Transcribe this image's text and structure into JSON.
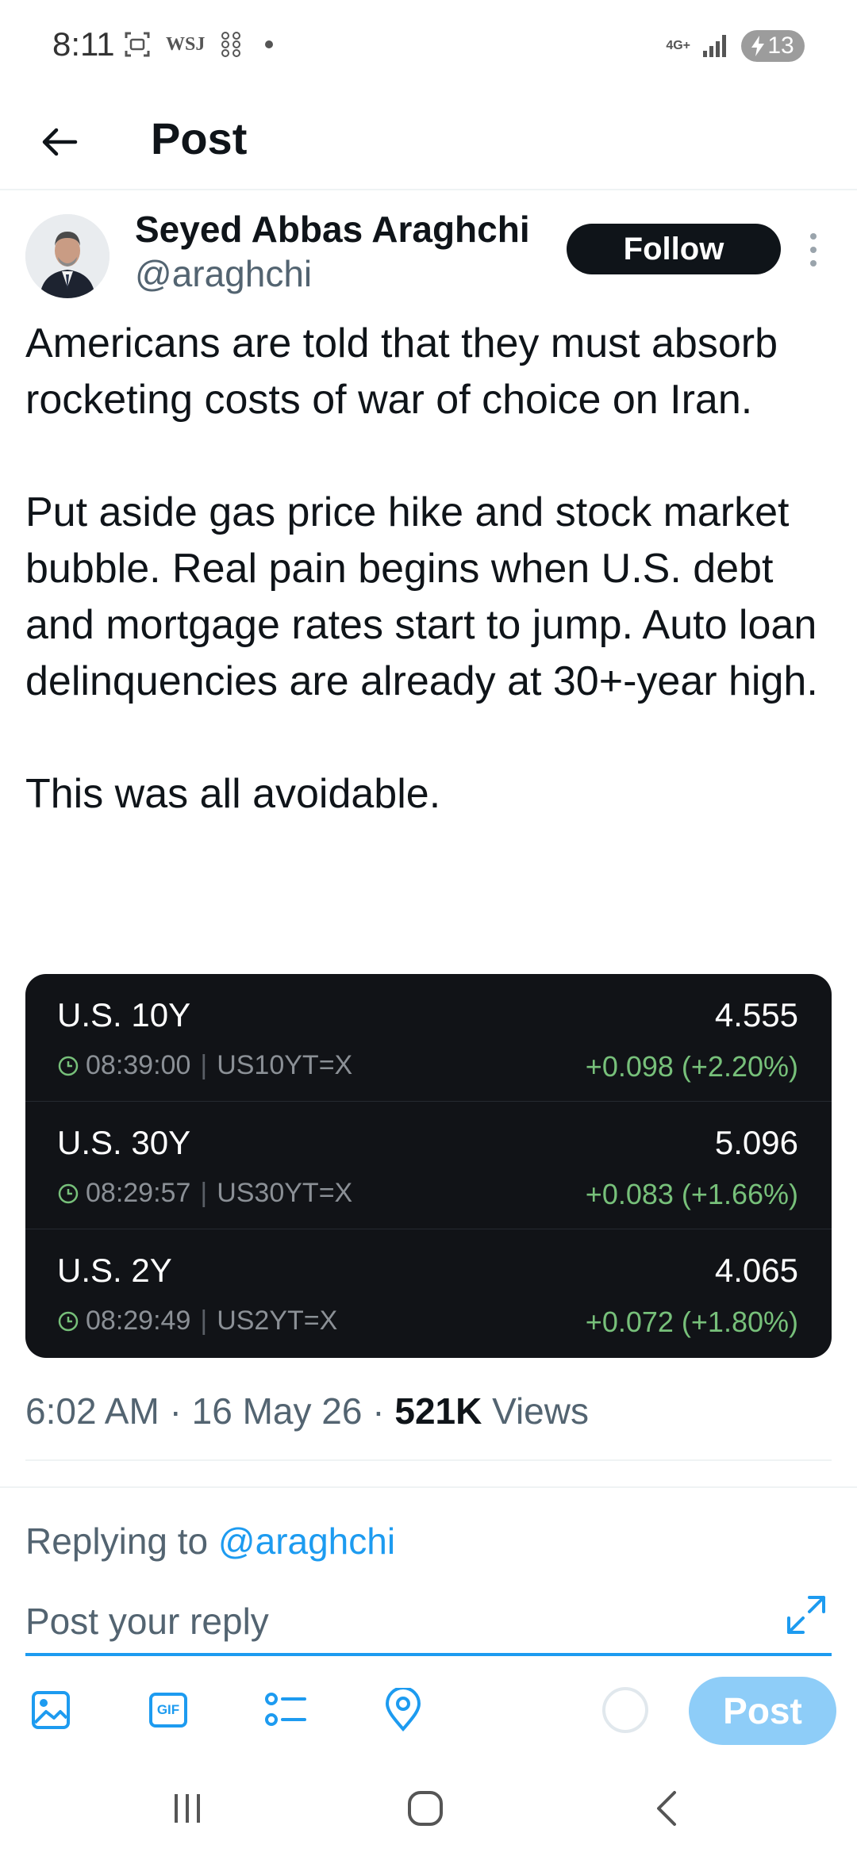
{
  "status_bar": {
    "time": "8:11",
    "left_icons": [
      "screenshot-icon",
      "wsj-icon",
      "grid-dots-icon",
      "notification-dot"
    ],
    "left_label_wsj": "WSJ",
    "network_label": "4G+",
    "battery_level": "13"
  },
  "header": {
    "title": "Post"
  },
  "author": {
    "name": "Seyed Abbas Araghchi",
    "handle": "@araghchi",
    "follow_label": "Follow"
  },
  "post": {
    "paragraphs": [
      "Americans are told that they must absorb rocketing costs of war of choice on Iran.",
      "Put aside gas price hike and stock market bubble. Real pain begins when U.S. debt and mortgage rates start to jump. Auto loan delinquencies are already at 30+-year high.",
      "This was all avoidable."
    ]
  },
  "quote_card": {
    "rows": [
      {
        "name": "U.S. 10Y",
        "value": "4.555",
        "time": "08:39:00",
        "symbol": "US10YT=X",
        "change": "+0.098 (+2.20%)"
      },
      {
        "name": "U.S. 30Y",
        "value": "5.096",
        "time": "08:29:57",
        "symbol": "US30YT=X",
        "change": "+0.083 (+1.66%)"
      },
      {
        "name": "U.S. 2Y",
        "value": "4.065",
        "time": "08:29:49",
        "symbol": "US2YT=X",
        "change": "+0.072 (+1.80%)"
      }
    ],
    "separator": "|"
  },
  "meta": {
    "time": "6:02 AM",
    "date": "16 May 26",
    "dot": "·",
    "views_count": "521K",
    "views_label": "Views"
  },
  "reply": {
    "replying_to_label": "Replying to",
    "replying_to_handle": "@araghchi",
    "placeholder": "Post your reply",
    "post_label": "Post"
  },
  "toolbar": {
    "icons": [
      "image-icon",
      "gif-icon",
      "poll-icon",
      "location-icon"
    ],
    "gif_label": "GIF"
  },
  "colors": {
    "accent": "#1d9bf0",
    "post_button_disabled": "#8ecdf8",
    "card_background": "#111317",
    "positive_change": "#77c07a",
    "secondary_text": "#536471"
  }
}
